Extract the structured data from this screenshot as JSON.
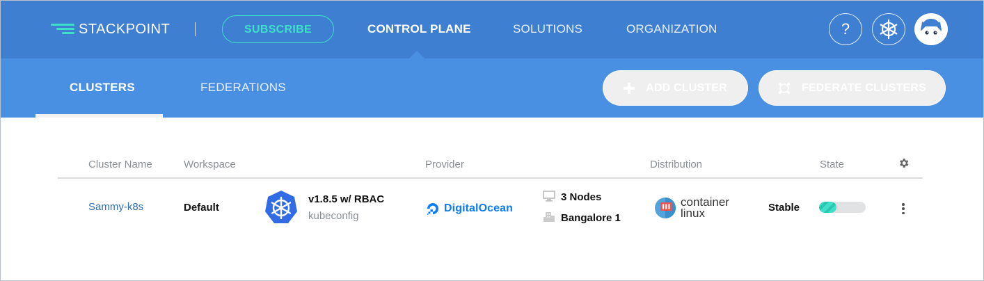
{
  "colors": {
    "topnav_bg": "#3f7fd1",
    "subnav_bg": "#4a90e2",
    "accent_teal": "#3ee0c9",
    "link_blue": "#2f6fb8",
    "digitalocean_blue": "#0a7cf5"
  },
  "topnav": {
    "logo_text": "STACKPOINT",
    "subscribe_label": "SUBSCRIBE",
    "links": [
      "CONTROL PLANE",
      "SOLUTIONS",
      "ORGANIZATION"
    ],
    "active_link": "CONTROL PLANE",
    "help_label": "?",
    "icons": [
      "stackpoint-logo-icon",
      "help-icon",
      "kubernetes-helm-icon",
      "user-avatar-icon"
    ]
  },
  "subnav": {
    "tabs": [
      "CLUSTERS",
      "FEDERATIONS"
    ],
    "active_tab": "CLUSTERS",
    "add_cluster_label": "ADD CLUSTER",
    "federate_label": "FEDERATE CLUSTERS",
    "icons": [
      "plus-icon",
      "federate-icon"
    ]
  },
  "table": {
    "headers": {
      "cluster_name": "Cluster Name",
      "workspace": "Workspace",
      "provider": "Provider",
      "distribution": "Distribution",
      "state": "State"
    },
    "settings_icon": "gear-icon",
    "rows": [
      {
        "cluster_name": "Sammy-k8s",
        "workspace": "Default",
        "version": "v1.8.5 w/ RBAC",
        "kubeconfig": "kubeconfig",
        "provider": "DigitalOcean",
        "nodes": "3 Nodes",
        "region": "Bangalore 1",
        "distribution_line1": "container",
        "distribution_line2": "linux",
        "state": "Stable",
        "state_progress": 0.38,
        "icons": [
          "kubernetes-icon",
          "digitalocean-icon",
          "monitor-icon",
          "building-icon",
          "container-linux-icon",
          "kebab-menu-icon"
        ]
      }
    ]
  }
}
